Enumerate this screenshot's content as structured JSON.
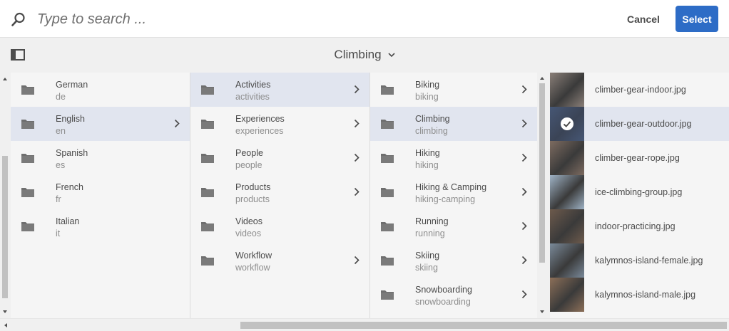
{
  "search": {
    "placeholder": "Type to search ..."
  },
  "actions": {
    "cancel_label": "Cancel",
    "select_label": "Select"
  },
  "colors": {
    "accent": "#2d6cc6",
    "selection_bg": "#e1e5ef"
  },
  "header": {
    "title": "Climbing"
  },
  "columns": [
    {
      "items": [
        {
          "title": "German",
          "subtitle": "de",
          "selected": false,
          "has_children": false
        },
        {
          "title": "English",
          "subtitle": "en",
          "selected": true,
          "has_children": true
        },
        {
          "title": "Spanish",
          "subtitle": "es",
          "selected": false,
          "has_children": false
        },
        {
          "title": "French",
          "subtitle": "fr",
          "selected": false,
          "has_children": false
        },
        {
          "title": "Italian",
          "subtitle": "it",
          "selected": false,
          "has_children": false
        }
      ]
    },
    {
      "items": [
        {
          "title": "Activities",
          "subtitle": "activities",
          "selected": true,
          "has_children": true
        },
        {
          "title": "Experiences",
          "subtitle": "experiences",
          "selected": false,
          "has_children": true
        },
        {
          "title": "People",
          "subtitle": "people",
          "selected": false,
          "has_children": true
        },
        {
          "title": "Products",
          "subtitle": "products",
          "selected": false,
          "has_children": true
        },
        {
          "title": "Videos",
          "subtitle": "videos",
          "selected": false,
          "has_children": false
        },
        {
          "title": "Workflow",
          "subtitle": "workflow",
          "selected": false,
          "has_children": true
        }
      ]
    },
    {
      "items": [
        {
          "title": "Biking",
          "subtitle": "biking",
          "selected": false,
          "has_children": true
        },
        {
          "title": "Climbing",
          "subtitle": "climbing",
          "selected": true,
          "has_children": true
        },
        {
          "title": "Hiking",
          "subtitle": "hiking",
          "selected": false,
          "has_children": true
        },
        {
          "title": "Hiking & Camping",
          "subtitle": "hiking-camping",
          "selected": false,
          "has_children": true
        },
        {
          "title": "Running",
          "subtitle": "running",
          "selected": false,
          "has_children": true
        },
        {
          "title": "Skiing",
          "subtitle": "skiing",
          "selected": false,
          "has_children": true
        },
        {
          "title": "Snowboarding",
          "subtitle": "snowboarding",
          "selected": false,
          "has_children": true
        }
      ]
    }
  ],
  "assets": [
    {
      "name": "climber-gear-indoor.jpg",
      "selected": false,
      "thumb_color": "#8a7f78"
    },
    {
      "name": "climber-gear-outdoor.jpg",
      "selected": true,
      "thumb_color": "#4f5d73"
    },
    {
      "name": "climber-gear-rope.jpg",
      "selected": false,
      "thumb_color": "#7d6b60"
    },
    {
      "name": "ice-climbing-group.jpg",
      "selected": false,
      "thumb_color": "#9fb3c6"
    },
    {
      "name": "indoor-practicing.jpg",
      "selected": false,
      "thumb_color": "#6d5a4c"
    },
    {
      "name": "kalymnos-island-female.jpg",
      "selected": false,
      "thumb_color": "#7a8a9a"
    },
    {
      "name": "kalymnos-island-male.jpg",
      "selected": false,
      "thumb_color": "#8c6f58"
    }
  ]
}
